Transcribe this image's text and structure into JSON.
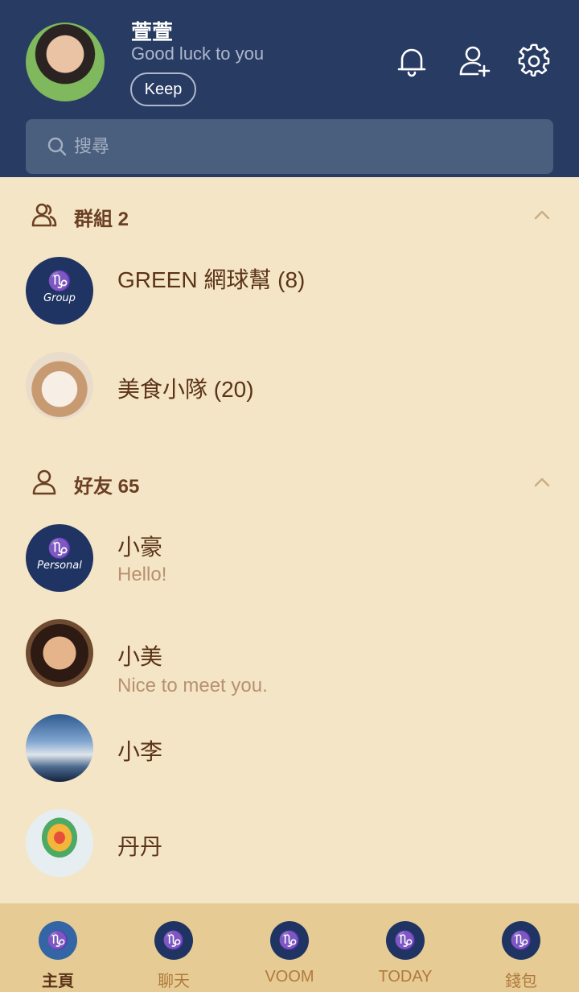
{
  "profile": {
    "name": "萱萱",
    "status": "Good luck to you",
    "keep_label": "Keep"
  },
  "search": {
    "placeholder": "搜尋",
    "value": ""
  },
  "groups_section": {
    "title": "群組 2",
    "items": [
      {
        "name": "GREEN 網球幫 (8)",
        "avatar": "navy-group-logo",
        "avatar_glyph": "♑",
        "avatar_sub": "Group"
      },
      {
        "name": "美食小隊 (20)",
        "avatar": "cat-photo"
      }
    ]
  },
  "friends_section": {
    "title": "好友 65",
    "items": [
      {
        "name": "小豪",
        "message": "Hello!",
        "avatar": "navy-personal-logo",
        "avatar_glyph": "♑",
        "avatar_sub": "Personal"
      },
      {
        "name": "小美",
        "message": "Nice to meet you.",
        "avatar": "woman-photo"
      },
      {
        "name": "小李",
        "message": "",
        "avatar": "sky-photo"
      },
      {
        "name": "丹丹",
        "message": "",
        "avatar": "balloon-photo"
      }
    ]
  },
  "nav": {
    "items": [
      {
        "label": "主頁",
        "icon": "capricorn-icon",
        "active": true
      },
      {
        "label": "聊天",
        "icon": "capricorn-icon",
        "active": false
      },
      {
        "label": "VOOM",
        "icon": "capricorn-icon",
        "active": false
      },
      {
        "label": "TODAY",
        "icon": "capricorn-icon",
        "active": false
      },
      {
        "label": "錢包",
        "icon": "capricorn-icon",
        "active": false
      }
    ],
    "glyph": "♑"
  },
  "colors": {
    "header_bg": "#283b63",
    "body_bg": "#f4e5c6",
    "nav_bg": "#e6cb95",
    "accent_navy": "#1f3463",
    "text_brown": "#5b3318"
  }
}
